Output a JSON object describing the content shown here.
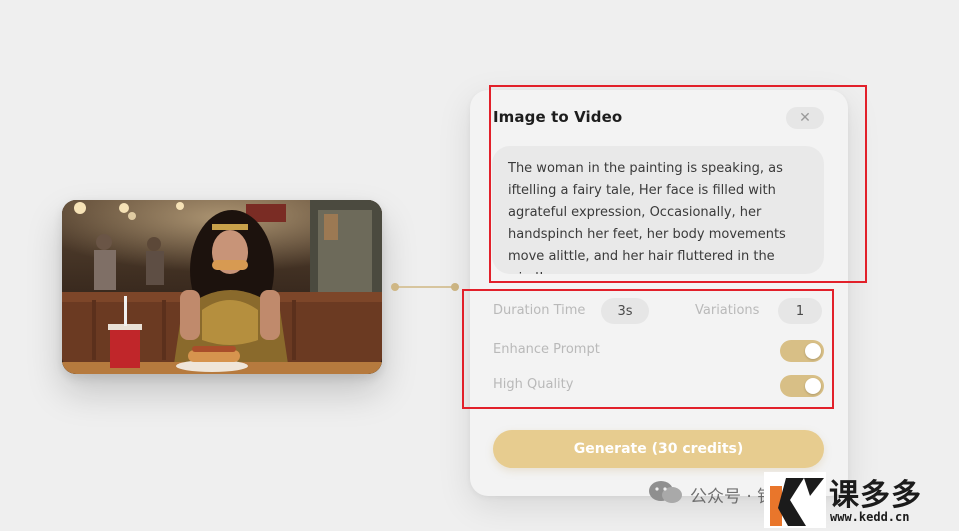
{
  "panel": {
    "title": "Image to Video",
    "close_icon": "close-icon",
    "prompt": "The woman in the painting is speaking, as iftelling a fairy tale, Her face is filled with agrateful expression, Occasionally, her handspinch her feet, her body movements move alittle, and her hair fluttered in the wind!",
    "duration_label": "Duration Time",
    "duration_value": "3s",
    "variations_label": "Variations",
    "variations_value": "1",
    "enhance_label": "Enhance Prompt",
    "enhance_on": true,
    "quality_label": "High Quality",
    "quality_on": true,
    "generate_label": "Generate (30 credits)"
  },
  "colors": {
    "accent": "#d8bf86",
    "button": "#e7cc8f",
    "annotation": "#e2202a"
  },
  "watermark": {
    "wechat_icon": "wechat-icon",
    "account_text": "公众号 · 铅",
    "brand": "课多多",
    "url": "www.kedd.cn"
  }
}
